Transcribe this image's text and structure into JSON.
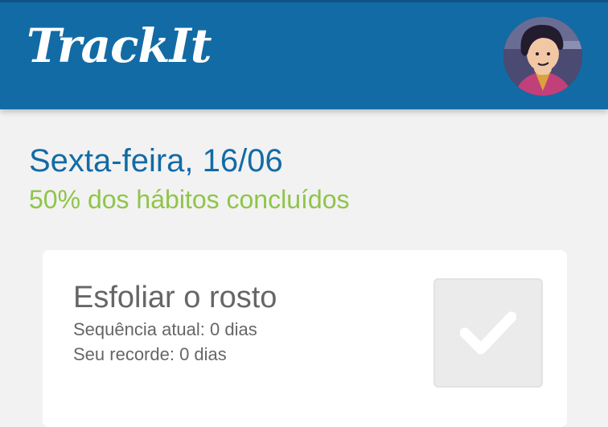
{
  "header": {
    "app_name": "TrackIt",
    "background_color": "#126ba5",
    "avatar_icon": "user-avatar"
  },
  "today": {
    "date_label": "Sexta-feira, 16/06",
    "progress_label": "50% dos hábitos concluídos",
    "progress_percent": 50,
    "progress_color": "#8fc549"
  },
  "habits": [
    {
      "name": "Esfoliar o rosto",
      "current_streak": "Sequência atual: 0 dias",
      "record": "Seu recorde: 0 dias",
      "done": false,
      "check_icon": "checkmark-icon"
    }
  ]
}
